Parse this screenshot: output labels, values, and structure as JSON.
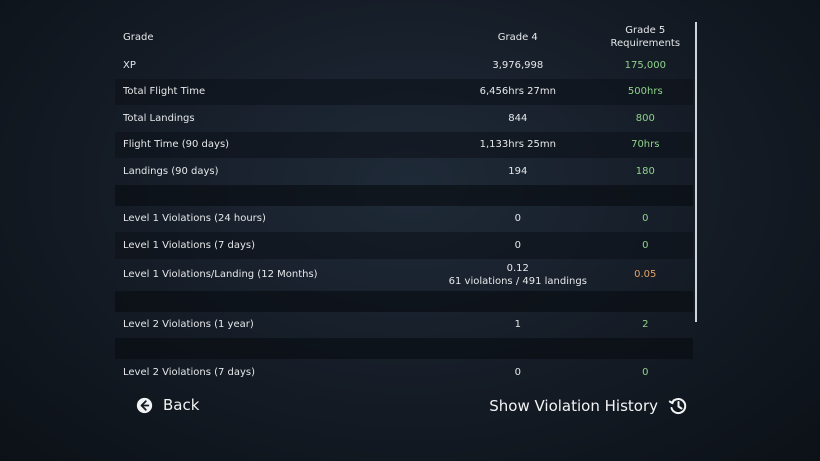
{
  "table": {
    "header": {
      "label": "Grade",
      "current": "Grade 4",
      "requirement": "Grade 5\nRequirements"
    },
    "rows": [
      {
        "label": "XP",
        "value": "3,976,998",
        "req": "175,000"
      },
      {
        "label": "Total Flight Time",
        "value": "6,456hrs 27mn",
        "req": "500hrs"
      },
      {
        "label": "Total Landings",
        "value": "844",
        "req": "800"
      },
      {
        "label": "Flight Time (90 days)",
        "value": "1,133hrs 25mn",
        "req": "70hrs"
      },
      {
        "label": "Landings (90 days)",
        "value": "194",
        "req": "180"
      },
      {
        "label": "Level 1 Violations (24 hours)",
        "value": "0",
        "req": "0"
      },
      {
        "label": "Level 1 Violations (7 days)",
        "value": "0",
        "req": "0"
      },
      {
        "label": "Level 1 Violations/Landing (12 Months)",
        "value_line1": "0.12",
        "value_line2": "61 violations / 491 landings",
        "req": "0.05"
      },
      {
        "label": "Level 2 Violations (1 year)",
        "value": "1",
        "req": "2"
      },
      {
        "label": "Level 2 Violations (7 days)",
        "value": "0",
        "req": "0"
      }
    ]
  },
  "footer": {
    "back_label": "Back",
    "history_label": "Show Violation History"
  },
  "colors": {
    "met": "#8fd28b",
    "not_met": "#e3a062"
  },
  "icons": {
    "back": "arrow-left-circle-icon",
    "history": "history-icon"
  }
}
